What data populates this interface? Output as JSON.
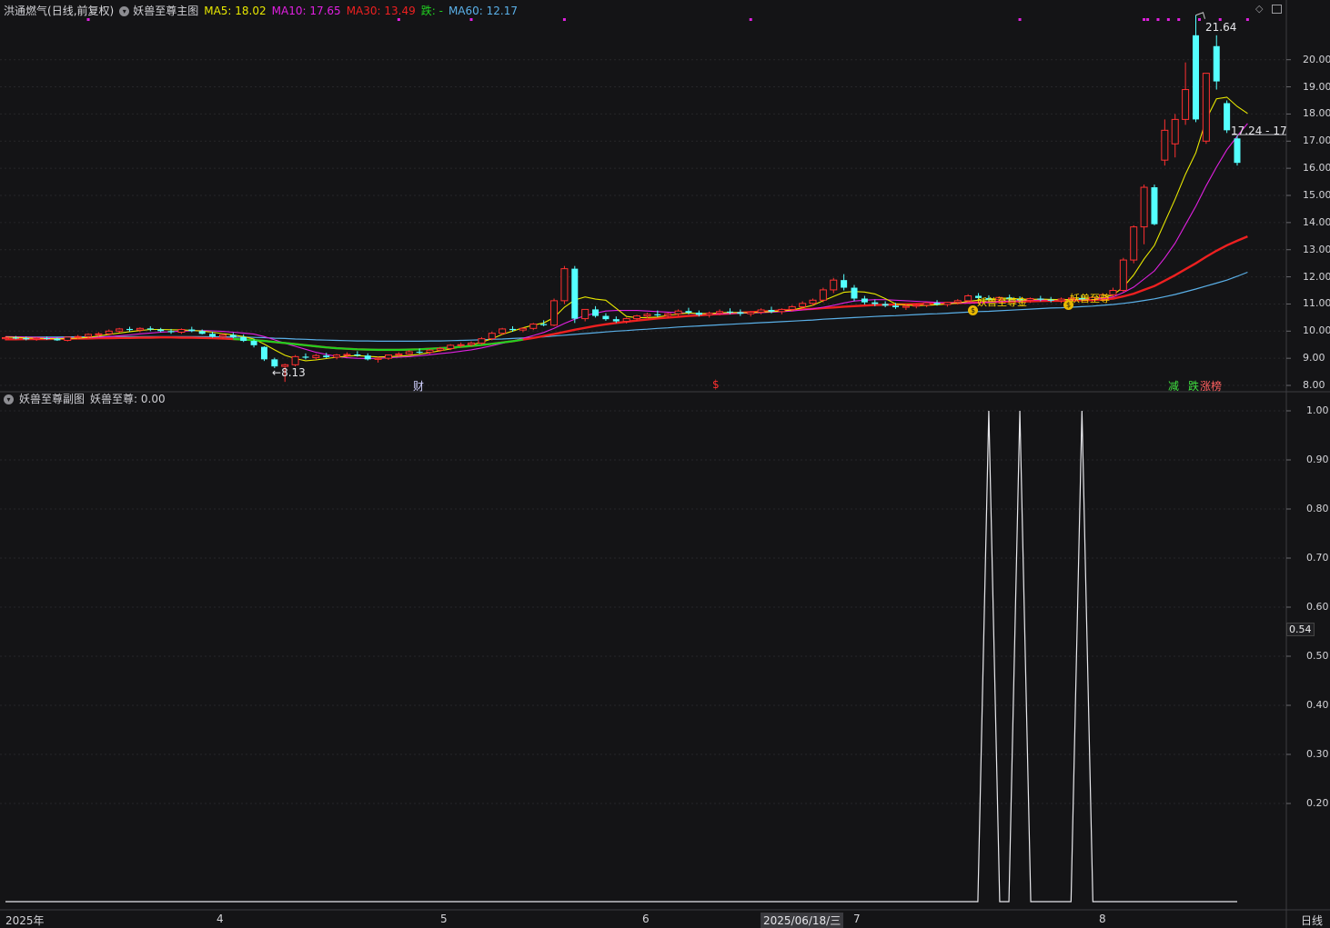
{
  "main_chart": {
    "stock_name": "洪通燃气",
    "stock_mode": "(日线,前复权)",
    "indicator_name": "妖兽至尊主图",
    "ma": [
      {
        "label": "MA5:",
        "value": "18.02",
        "color": "#e8e800"
      },
      {
        "label": "MA10:",
        "value": "17.65",
        "color": "#e020e0"
      },
      {
        "label": "MA30:",
        "value": "13.49",
        "color": "#ee2020"
      },
      {
        "label": "跌:",
        "value": "-",
        "color": "#20d020"
      },
      {
        "label": "MA60:",
        "value": "12.17",
        "color": "#5ab0e8"
      }
    ],
    "high_label": "21.64",
    "low_label": "8.13",
    "cursor_price": "17.24 - 17",
    "marks": {
      "cai": "财",
      "dollar": "$",
      "jian": "减",
      "die": "跌",
      "zhangbang": "涨榜",
      "mark1": "妖兽至尊金",
      "mark2": "妖兽至尊"
    },
    "y_axis": [
      "20.00",
      "19.00",
      "18.00",
      "17.00",
      "16.00",
      "15.00",
      "14.00",
      "13.00",
      "12.00",
      "11.00",
      "10.00",
      "9.00",
      "8.00"
    ]
  },
  "sub_chart": {
    "title": "妖兽至尊副图",
    "value_label": "妖兽至尊: 0.00",
    "y_axis": [
      "1.00",
      "0.90",
      "0.80",
      "0.70",
      "0.60",
      "0.50",
      "0.40",
      "0.30",
      "0.20"
    ],
    "cursor_value": "0.54"
  },
  "x_axis": {
    "labels": [
      "2025年",
      "4",
      "5",
      "6",
      "7",
      "8"
    ],
    "cursor_date": "2025/06/18/三",
    "period": "日线"
  },
  "chart_data": {
    "type": "candlestick",
    "ylim": [
      7.8,
      22.2
    ],
    "up_color": "#ff3030",
    "down_color": "#54ffff",
    "candles": [
      [
        9.72,
        9.8,
        9.66,
        9.76
      ],
      [
        9.76,
        9.82,
        9.7,
        9.74
      ],
      [
        9.74,
        9.8,
        9.66,
        9.7
      ],
      [
        9.7,
        9.78,
        9.64,
        9.74
      ],
      [
        9.74,
        9.8,
        9.68,
        9.72
      ],
      [
        9.72,
        9.76,
        9.64,
        9.66
      ],
      [
        9.66,
        9.8,
        9.62,
        9.78
      ],
      [
        9.78,
        9.86,
        9.72,
        9.8
      ],
      [
        9.8,
        9.92,
        9.74,
        9.88
      ],
      [
        9.88,
        9.96,
        9.8,
        9.9
      ],
      [
        9.9,
        10.06,
        9.84,
        10.0
      ],
      [
        10.0,
        10.12,
        9.94,
        10.08
      ],
      [
        10.08,
        10.16,
        9.98,
        10.04
      ],
      [
        10.04,
        10.14,
        9.96,
        10.1
      ],
      [
        10.1,
        10.18,
        10.0,
        10.06
      ],
      [
        10.06,
        10.12,
        9.96,
        10.0
      ],
      [
        10.0,
        10.08,
        9.9,
        9.96
      ],
      [
        9.96,
        10.1,
        9.9,
        10.06
      ],
      [
        10.06,
        10.16,
        9.96,
        10.0
      ],
      [
        10.0,
        10.06,
        9.88,
        9.9
      ],
      [
        9.9,
        9.98,
        9.76,
        9.8
      ],
      [
        9.8,
        9.92,
        9.72,
        9.86
      ],
      [
        9.86,
        9.94,
        9.74,
        9.78
      ],
      [
        9.78,
        9.88,
        9.6,
        9.64
      ],
      [
        9.64,
        9.7,
        9.4,
        9.48
      ],
      [
        9.42,
        9.44,
        8.9,
        8.96
      ],
      [
        8.96,
        9.02,
        8.64,
        8.7
      ],
      [
        8.7,
        8.8,
        8.13,
        8.76
      ],
      [
        8.76,
        9.12,
        8.7,
        9.06
      ],
      [
        9.06,
        9.18,
        8.96,
        9.02
      ],
      [
        9.02,
        9.16,
        8.94,
        9.1
      ],
      [
        9.1,
        9.2,
        9.0,
        9.04
      ],
      [
        9.04,
        9.16,
        8.96,
        9.12
      ],
      [
        9.12,
        9.22,
        9.04,
        9.14
      ],
      [
        9.14,
        9.26,
        9.06,
        9.1
      ],
      [
        9.1,
        9.18,
        8.92,
        8.96
      ],
      [
        8.96,
        9.06,
        8.84,
        9.0
      ],
      [
        9.0,
        9.14,
        8.94,
        9.12
      ],
      [
        9.12,
        9.22,
        9.06,
        9.16
      ],
      [
        9.16,
        9.3,
        9.1,
        9.24
      ],
      [
        9.24,
        9.36,
        9.16,
        9.22
      ],
      [
        9.22,
        9.34,
        9.16,
        9.3
      ],
      [
        9.3,
        9.42,
        9.24,
        9.36
      ],
      [
        9.36,
        9.52,
        9.3,
        9.48
      ],
      [
        9.48,
        9.58,
        9.4,
        9.5
      ],
      [
        9.5,
        9.62,
        9.44,
        9.56
      ],
      [
        9.56,
        9.78,
        9.5,
        9.72
      ],
      [
        9.72,
        9.98,
        9.66,
        9.92
      ],
      [
        9.92,
        10.12,
        9.86,
        10.08
      ],
      [
        10.08,
        10.18,
        9.98,
        10.04
      ],
      [
        10.04,
        10.14,
        9.96,
        10.1
      ],
      [
        10.1,
        10.3,
        10.04,
        10.26
      ],
      [
        10.26,
        10.4,
        10.18,
        10.22
      ],
      [
        10.22,
        11.2,
        10.18,
        11.12
      ],
      [
        11.12,
        12.4,
        11.0,
        12.3
      ],
      [
        12.3,
        12.4,
        10.3,
        10.46
      ],
      [
        10.46,
        10.78,
        10.36,
        10.8
      ],
      [
        10.8,
        10.92,
        10.5,
        10.56
      ],
      [
        10.56,
        10.66,
        10.38,
        10.44
      ],
      [
        10.44,
        10.54,
        10.3,
        10.36
      ],
      [
        10.36,
        10.5,
        10.28,
        10.46
      ],
      [
        10.46,
        10.6,
        10.38,
        10.56
      ],
      [
        10.56,
        10.68,
        10.48,
        10.62
      ],
      [
        10.62,
        10.76,
        10.52,
        10.58
      ],
      [
        10.58,
        10.68,
        10.48,
        10.64
      ],
      [
        10.64,
        10.8,
        10.56,
        10.74
      ],
      [
        10.74,
        10.86,
        10.62,
        10.68
      ],
      [
        10.68,
        10.76,
        10.54,
        10.6
      ],
      [
        10.6,
        10.72,
        10.5,
        10.66
      ],
      [
        10.66,
        10.8,
        10.58,
        10.72
      ],
      [
        10.72,
        10.84,
        10.62,
        10.7
      ],
      [
        10.7,
        10.8,
        10.56,
        10.64
      ],
      [
        10.64,
        10.74,
        10.54,
        10.7
      ],
      [
        10.7,
        10.84,
        10.62,
        10.78
      ],
      [
        10.78,
        10.9,
        10.66,
        10.72
      ],
      [
        10.72,
        10.84,
        10.62,
        10.8
      ],
      [
        10.8,
        10.96,
        10.72,
        10.9
      ],
      [
        10.9,
        11.1,
        10.82,
        11.02
      ],
      [
        11.02,
        11.2,
        10.94,
        11.14
      ],
      [
        11.14,
        11.6,
        11.06,
        11.52
      ],
      [
        11.52,
        11.96,
        11.4,
        11.88
      ],
      [
        11.88,
        12.1,
        11.5,
        11.6
      ],
      [
        11.6,
        11.7,
        11.1,
        11.2
      ],
      [
        11.2,
        11.3,
        10.98,
        11.06
      ],
      [
        11.06,
        11.16,
        10.92,
        11.0
      ],
      [
        11.0,
        11.1,
        10.88,
        10.94
      ],
      [
        10.94,
        11.04,
        10.82,
        10.88
      ],
      [
        10.88,
        10.98,
        10.78,
        10.92
      ],
      [
        10.92,
        11.02,
        10.84,
        10.96
      ],
      [
        10.96,
        11.08,
        10.88,
        11.04
      ],
      [
        11.04,
        11.14,
        10.94,
        10.98
      ],
      [
        10.98,
        11.08,
        10.9,
        11.06
      ],
      [
        11.06,
        11.18,
        10.98,
        11.12
      ],
      [
        11.12,
        11.36,
        11.06,
        11.3
      ],
      [
        11.3,
        11.4,
        11.16,
        11.22
      ],
      [
        11.22,
        11.32,
        11.1,
        11.16
      ],
      [
        11.16,
        11.28,
        11.08,
        11.24
      ],
      [
        11.24,
        11.34,
        11.12,
        11.18
      ],
      [
        11.18,
        11.28,
        11.08,
        11.14
      ],
      [
        11.14,
        11.24,
        11.04,
        11.2
      ],
      [
        11.2,
        11.3,
        11.1,
        11.16
      ],
      [
        11.16,
        11.26,
        11.06,
        11.12
      ],
      [
        11.12,
        11.24,
        11.04,
        11.18
      ],
      [
        11.18,
        11.3,
        11.1,
        11.22
      ],
      [
        11.22,
        11.32,
        11.12,
        11.16
      ],
      [
        11.16,
        11.28,
        11.08,
        11.24
      ],
      [
        11.24,
        11.4,
        11.16,
        11.34
      ],
      [
        11.34,
        11.6,
        11.26,
        11.5
      ],
      [
        11.5,
        12.7,
        11.44,
        12.62
      ],
      [
        12.62,
        13.9,
        12.5,
        13.84
      ],
      [
        13.84,
        15.4,
        13.2,
        15.3
      ],
      [
        15.3,
        15.4,
        13.9,
        13.94
      ],
      [
        16.3,
        17.8,
        16.1,
        17.4
      ],
      [
        16.9,
        18.0,
        16.4,
        17.8
      ],
      [
        17.8,
        19.9,
        17.6,
        18.9
      ],
      [
        20.9,
        21.64,
        17.7,
        17.8
      ],
      [
        17.0,
        19.5,
        16.9,
        19.5
      ],
      [
        20.5,
        20.9,
        18.9,
        19.2
      ],
      [
        18.4,
        18.5,
        17.3,
        17.4
      ],
      [
        17.1,
        17.2,
        16.1,
        16.2
      ]
    ],
    "ma5": [
      9.78,
      9.77,
      9.75,
      9.74,
      9.73,
      9.72,
      9.73,
      9.74,
      9.77,
      9.82,
      9.88,
      9.93,
      9.98,
      10.02,
      10.06,
      10.06,
      10.05,
      10.04,
      10.03,
      10.0,
      9.96,
      9.91,
      9.86,
      9.8,
      9.71,
      9.52,
      9.31,
      9.11,
      8.99,
      8.91,
      8.94,
      8.99,
      9.04,
      9.08,
      9.1,
      9.07,
      9.05,
      9.06,
      9.08,
      9.1,
      9.15,
      9.21,
      9.28,
      9.34,
      9.42,
      9.49,
      9.59,
      9.72,
      9.88,
      10.0,
      10.12,
      10.22,
      10.3,
      10.5,
      10.88,
      11.15,
      11.26,
      11.18,
      11.14,
      10.84,
      10.54,
      10.5,
      10.5,
      10.52,
      10.58,
      10.63,
      10.67,
      10.65,
      10.65,
      10.67,
      10.69,
      10.68,
      10.68,
      10.7,
      10.72,
      10.74,
      10.78,
      10.86,
      10.95,
      11.12,
      11.28,
      11.43,
      11.46,
      11.44,
      11.37,
      11.2,
      11.0,
      10.96,
      10.94,
      10.95,
      10.97,
      11.0,
      11.03,
      11.1,
      11.14,
      11.16,
      11.18,
      11.19,
      11.19,
      11.17,
      11.18,
      11.17,
      11.16,
      11.17,
      11.19,
      11.2,
      11.24,
      11.33,
      11.62,
      12.07,
      12.66,
      13.16,
      14.02,
      14.86,
      15.78,
      16.57,
      17.8,
      18.56,
      18.62,
      18.28,
      18.02
    ],
    "ma10": [
      9.8,
      9.79,
      9.78,
      9.77,
      9.76,
      9.75,
      9.75,
      9.75,
      9.76,
      9.78,
      9.8,
      9.83,
      9.86,
      9.9,
      9.93,
      9.96,
      9.98,
      10.0,
      10.01,
      10.02,
      10.01,
      9.99,
      9.96,
      9.93,
      9.89,
      9.8,
      9.68,
      9.55,
      9.44,
      9.33,
      9.22,
      9.14,
      9.07,
      9.02,
      9.0,
      8.99,
      9.0,
      9.02,
      9.04,
      9.06,
      9.09,
      9.13,
      9.17,
      9.21,
      9.26,
      9.31,
      9.38,
      9.46,
      9.55,
      9.64,
      9.74,
      9.84,
      9.95,
      10.1,
      10.28,
      10.44,
      10.57,
      10.66,
      10.74,
      10.76,
      10.76,
      10.76,
      10.74,
      10.72,
      10.7,
      10.68,
      10.66,
      10.64,
      10.64,
      10.64,
      10.65,
      10.66,
      10.67,
      10.68,
      10.7,
      10.72,
      10.74,
      10.78,
      10.82,
      10.88,
      10.95,
      11.04,
      11.11,
      11.14,
      11.16,
      11.16,
      11.14,
      11.12,
      11.1,
      11.08,
      11.06,
      11.05,
      11.04,
      11.04,
      11.05,
      11.07,
      11.09,
      11.11,
      11.12,
      11.14,
      11.15,
      11.16,
      11.16,
      11.16,
      11.17,
      11.17,
      11.2,
      11.26,
      11.42,
      11.62,
      11.92,
      12.22,
      12.7,
      13.24,
      13.92,
      14.6,
      15.36,
      16.04,
      16.68,
      17.18,
      17.65
    ],
    "ma30": [
      9.7,
      9.7,
      9.71,
      9.71,
      9.71,
      9.72,
      9.72,
      9.73,
      9.73,
      9.74,
      9.74,
      9.75,
      9.75,
      9.76,
      9.76,
      9.77,
      9.77,
      9.76,
      9.76,
      9.75,
      9.74,
      9.73,
      9.71,
      9.69,
      9.67,
      9.64,
      9.6,
      9.56,
      9.52,
      9.48,
      9.44,
      9.4,
      9.37,
      9.35,
      9.33,
      9.32,
      9.31,
      9.31,
      9.31,
      9.32,
      9.33,
      9.35,
      9.37,
      9.39,
      9.42,
      9.45,
      9.49,
      9.53,
      9.58,
      9.63,
      9.69,
      9.75,
      9.82,
      9.89,
      9.97,
      10.05,
      10.12,
      10.19,
      10.25,
      10.3,
      10.35,
      10.39,
      10.43,
      10.47,
      10.5,
      10.53,
      10.56,
      10.58,
      10.61,
      10.63,
      10.65,
      10.68,
      10.7,
      10.72,
      10.74,
      10.76,
      10.78,
      10.8,
      10.82,
      10.85,
      10.87,
      10.9,
      10.92,
      10.94,
      10.96,
      10.97,
      10.98,
      10.99,
      11.0,
      11.01,
      11.02,
      11.03,
      11.04,
      11.05,
      11.06,
      11.07,
      11.08,
      11.09,
      11.1,
      11.1,
      11.11,
      11.12,
      11.12,
      11.13,
      11.14,
      11.15,
      11.17,
      11.2,
      11.28,
      11.38,
      11.52,
      11.66,
      11.86,
      12.06,
      12.28,
      12.5,
      12.74,
      12.96,
      13.16,
      13.33,
      13.49
    ],
    "ma60": [
      9.78,
      9.78,
      9.78,
      9.78,
      9.78,
      9.78,
      9.79,
      9.79,
      9.79,
      9.79,
      9.8,
      9.8,
      9.8,
      9.8,
      9.8,
      9.8,
      9.8,
      9.8,
      9.8,
      9.8,
      9.79,
      9.79,
      9.78,
      9.78,
      9.77,
      9.76,
      9.74,
      9.73,
      9.71,
      9.7,
      9.68,
      9.67,
      9.66,
      9.65,
      9.64,
      9.64,
      9.63,
      9.63,
      9.63,
      9.63,
      9.63,
      9.64,
      9.64,
      9.65,
      9.66,
      9.67,
      9.68,
      9.7,
      9.71,
      9.73,
      9.75,
      9.77,
      9.79,
      9.82,
      9.85,
      9.88,
      9.91,
      9.94,
      9.97,
      10.0,
      10.02,
      10.05,
      10.07,
      10.1,
      10.12,
      10.15,
      10.17,
      10.19,
      10.21,
      10.23,
      10.25,
      10.27,
      10.29,
      10.31,
      10.33,
      10.35,
      10.37,
      10.39,
      10.41,
      10.44,
      10.46,
      10.48,
      10.5,
      10.52,
      10.54,
      10.56,
      10.57,
      10.59,
      10.61,
      10.63,
      10.64,
      10.66,
      10.68,
      10.7,
      10.72,
      10.73,
      10.75,
      10.77,
      10.79,
      10.81,
      10.83,
      10.85,
      10.86,
      10.88,
      10.9,
      10.92,
      10.95,
      10.98,
      11.02,
      11.07,
      11.13,
      11.19,
      11.27,
      11.35,
      11.45,
      11.55,
      11.66,
      11.77,
      11.88,
      12.02,
      12.17
    ],
    "sub_series": {
      "spikes_at": [
        95,
        98,
        104
      ],
      "ylim": [
        0,
        1.0
      ]
    }
  }
}
